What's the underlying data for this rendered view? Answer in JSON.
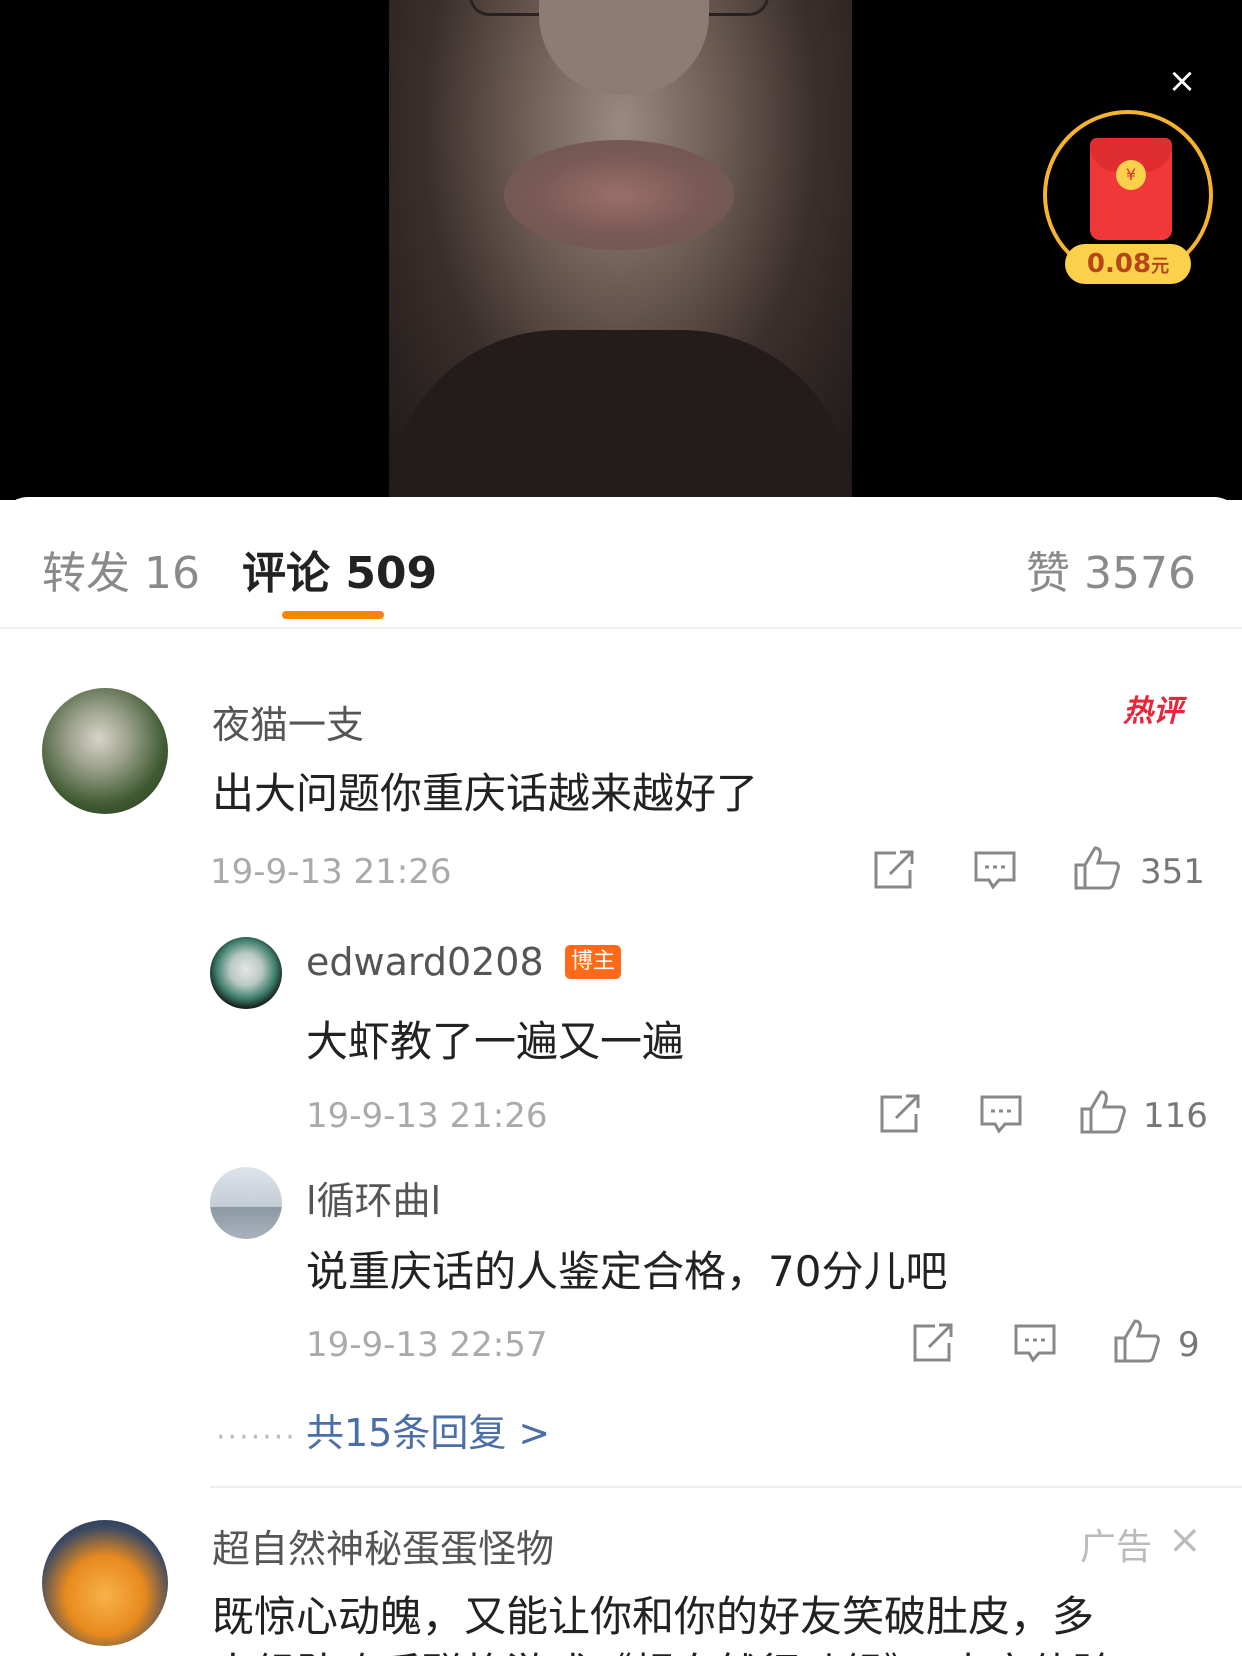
{
  "red_packet": {
    "amount": "0.08",
    "unit": "元",
    "coin_symbol": "¥"
  },
  "tabs": [
    {
      "label": "转发 16"
    },
    {
      "label": "评论 509"
    },
    {
      "label": "赞 3576"
    }
  ],
  "comments": [
    {
      "user": "夜猫一支",
      "badge": "热评",
      "text": "出大问题你重庆话越来越好了",
      "time": "19-9-13 21:26",
      "likes": "351"
    },
    {
      "user": "edward0208",
      "badge": "博主",
      "text": "大虾教了一遍又一遍",
      "time": "19-9-13 21:26",
      "likes": "116"
    },
    {
      "user": "l循环曲l",
      "text": "说重庆话的人鉴定合格，70分儿吧",
      "time": "19-9-13 22:57",
      "likes": "9"
    }
  ],
  "more_replies": "共15条回复 >",
  "ad": {
    "user": "超自然神秘蛋蛋怪物",
    "label": "广告",
    "text": "既惊心动魄，又能让你和你的好友笑破肚皮，多",
    "text2": "人组队攻后聪格游戏《超自然行动组》，真实体验"
  }
}
